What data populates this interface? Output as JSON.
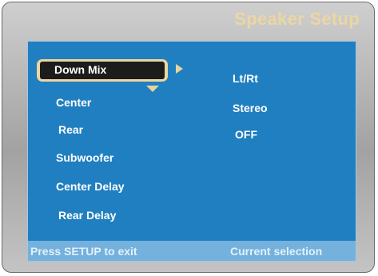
{
  "title": "Speaker Setup",
  "menu": {
    "selected_index": 0,
    "items": [
      {
        "label": "Down Mix"
      },
      {
        "label": "Center"
      },
      {
        "label": "Rear"
      },
      {
        "label": "Subwoofer"
      },
      {
        "label": "Center Delay"
      },
      {
        "label": "Rear Delay"
      }
    ]
  },
  "options": [
    "Lt/Rt",
    "Stereo",
    "OFF"
  ],
  "footer": {
    "hint": "Press SETUP to exit",
    "status": "Current selection"
  },
  "colors": {
    "panel": "#207fc0",
    "footer": "#74b1dd",
    "accent": "#edd7a0",
    "selection_fill": "#1c1c1c"
  },
  "icons": [
    "arrow-right-icon",
    "arrow-down-icon"
  ]
}
